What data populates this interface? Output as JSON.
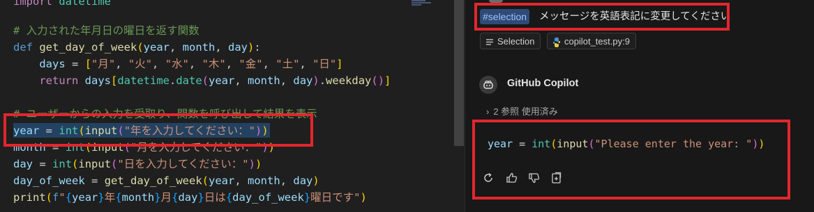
{
  "editor": {
    "lines": [
      {
        "t": "import datetime"
      },
      {
        "t": ""
      },
      {
        "t": "# 入力された年月日の曜日を返す関数"
      },
      {
        "t": "def get_day_of_week(year, month, day):"
      },
      {
        "t": "    days = [\"月\", \"火\", \"水\", \"木\", \"金\", \"土\", \"日\"]"
      },
      {
        "t": "    return days[datetime.date(year, month, day).weekday()]"
      },
      {
        "t": ""
      },
      {
        "t": "# ユーザーからの入力を受取り、関数を呼び出して結果を表示"
      },
      {
        "t": "year = int(input(\"年を入力してください：\"))"
      },
      {
        "t": "month = int(input(\"月を入力してください：\"))"
      },
      {
        "t": "day = int(input(\"日を入力してください：\"))"
      },
      {
        "t": "day_of_week = get_day_of_week(year, month, day)"
      },
      {
        "t": "print(f\"{year}年{month}月{day}日は{day_of_week}曜日です\")"
      }
    ]
  },
  "chat": {
    "selection_chip": "#selection",
    "user_message": "メッセージを英語表記に変更してください",
    "references": [
      {
        "label": "Selection",
        "icon": "list-icon"
      },
      {
        "label": "copilot_test.py:9",
        "icon": "python-icon"
      }
    ],
    "assistant_name": "GitHub Copilot",
    "refs_used": "2 参照 使用済み",
    "code": "year = int(input(\"Please enter the year: \"))",
    "actions": [
      {
        "name": "retry-icon"
      },
      {
        "name": "thumbs-up-icon"
      },
      {
        "name": "thumbs-down-icon"
      },
      {
        "name": "insert-icon"
      }
    ]
  },
  "colors": {
    "highlight": "#e3262d",
    "selection_chip_bg": "#2f4a76"
  }
}
